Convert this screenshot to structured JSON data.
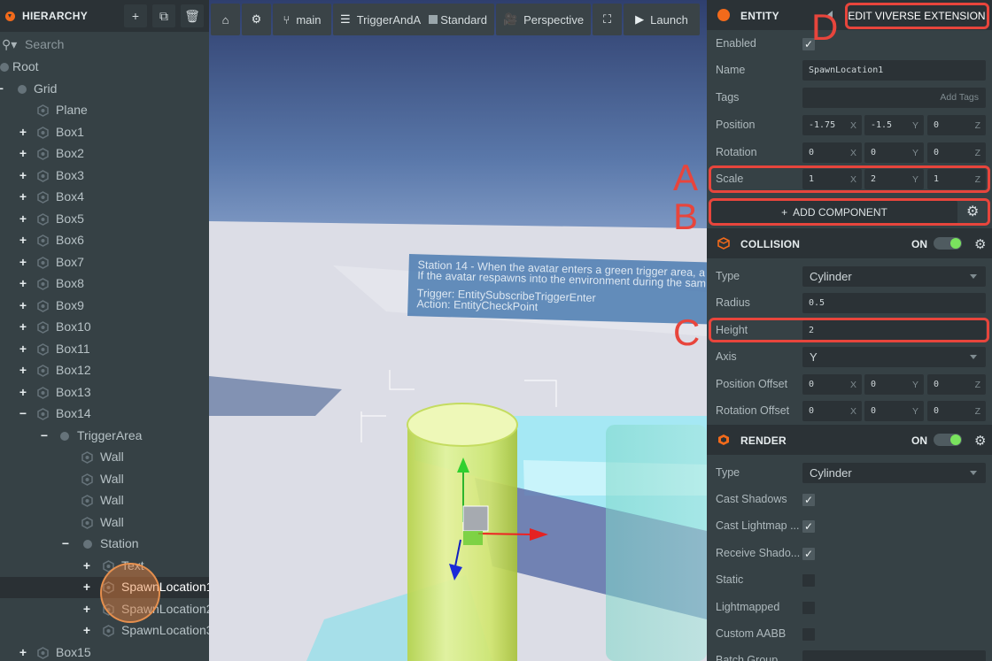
{
  "hierarchy": {
    "title": "HIERARCHY",
    "search_placeholder": "Search",
    "nodes": [
      {
        "label": "Root"
      },
      {
        "label": "Grid"
      },
      {
        "label": "Plane"
      },
      {
        "label": "Box1"
      },
      {
        "label": "Box2"
      },
      {
        "label": "Box3"
      },
      {
        "label": "Box4"
      },
      {
        "label": "Box5"
      },
      {
        "label": "Box6"
      },
      {
        "label": "Box7"
      },
      {
        "label": "Box8"
      },
      {
        "label": "Box9"
      },
      {
        "label": "Box10"
      },
      {
        "label": "Box11"
      },
      {
        "label": "Box12"
      },
      {
        "label": "Box13"
      },
      {
        "label": "Box14"
      },
      {
        "label": "TriggerArea"
      },
      {
        "label": "Wall"
      },
      {
        "label": "Wall"
      },
      {
        "label": "Wall"
      },
      {
        "label": "Wall"
      },
      {
        "label": "Station"
      },
      {
        "label": "Text"
      },
      {
        "label": "SpawnLocation1"
      },
      {
        "label": "SpawnLocation2"
      },
      {
        "label": "SpawnLocation3"
      },
      {
        "label": "Box15"
      }
    ]
  },
  "toolbar": {
    "branch": "main",
    "scene": "TriggerAndA",
    "standard": "Standard",
    "perspective": "Perspective",
    "launch": "Launch"
  },
  "viewport_note": {
    "line1": "Station 14 - When the avatar enters a green trigger area, a",
    "line2": "If the avatar respawns into the environment during the sam",
    "line3": "Trigger: EntitySubscribeTriggerEnter",
    "line4": "Action: EntityCheckPoint"
  },
  "inspector": {
    "entity_title": "ENTITY",
    "edit_extension": "EDIT VIVERSE EXTENSION",
    "labels": {
      "enabled": "Enabled",
      "name": "Name",
      "tags": "Tags",
      "position": "Position",
      "rotation": "Rotation",
      "scale": "Scale"
    },
    "name_value": "SpawnLocation1",
    "tags_hint": "Add Tags",
    "position": [
      "-1.75",
      "-1.5",
      "0"
    ],
    "rotation": [
      "0",
      "0",
      "0"
    ],
    "scale": [
      "1",
      "2",
      "1"
    ],
    "axes": [
      "X",
      "Y",
      "Z"
    ],
    "add_component": "ADD COMPONENT",
    "collision": {
      "title": "COLLISION",
      "on": "ON",
      "type_label": "Type",
      "type_value": "Cylinder",
      "radius_label": "Radius",
      "radius_value": "0.5",
      "height_label": "Height",
      "height_value": "2",
      "axis_label": "Axis",
      "axis_value": "Y",
      "pos_offset_label": "Position Offset",
      "pos_offset": [
        "0",
        "0",
        "0"
      ],
      "rot_offset_label": "Rotation Offset",
      "rot_offset": [
        "0",
        "0",
        "0"
      ]
    },
    "render": {
      "title": "RENDER",
      "on": "ON",
      "type_label": "Type",
      "type_value": "Cylinder",
      "cast_shadows": "Cast Shadows",
      "cast_lightmap": "Cast Lightmap ...",
      "receive_shadows": "Receive Shado...",
      "static": "Static",
      "lightmapped": "Lightmapped",
      "custom_aabb": "Custom AABB",
      "batch_group": "Batch Group"
    }
  },
  "annotations": {
    "a": "A",
    "b": "B",
    "c": "C",
    "d": "D"
  },
  "colors": {
    "accent": "#f26a1b",
    "annotation": "#e8453c",
    "toggle_on": "#7ae35e",
    "panel": "#364145"
  }
}
